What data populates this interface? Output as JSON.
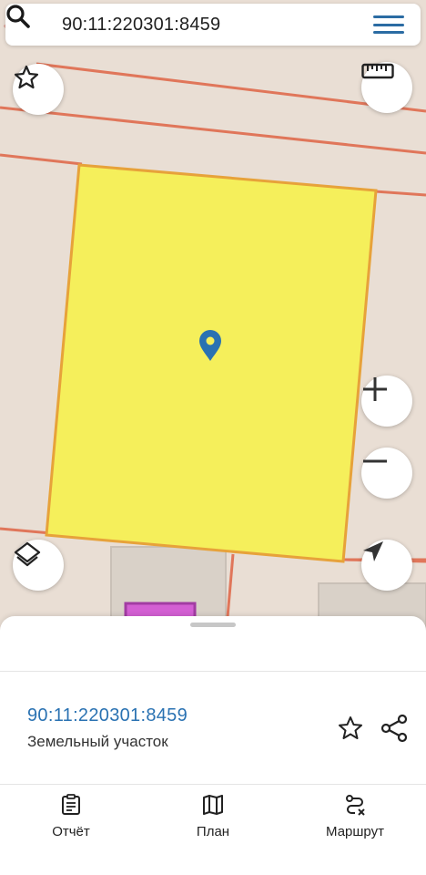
{
  "search": {
    "query": "90:11:220301:8459"
  },
  "map_controls": {
    "favorite": "star-icon",
    "ruler": "ruler-icon",
    "layers": "layers-icon",
    "zoom_in": "plus-icon",
    "zoom_out": "minus-icon",
    "locate": "location-arrow-icon"
  },
  "colors": {
    "parcel_fill": "#f5ef5b",
    "parcel_border": "#e7a23a",
    "boundary_lines": "#e0765a",
    "pin": "#2a72b2",
    "accent": "#2a72b2"
  },
  "card": {
    "cadastral_number": "90:11:220301:8459",
    "object_type": "Земельный участок"
  },
  "tabs": [
    {
      "label": "Отчёт",
      "icon": "report-icon"
    },
    {
      "label": "План",
      "icon": "map-icon"
    },
    {
      "label": "Маршрут",
      "icon": "route-icon"
    }
  ]
}
